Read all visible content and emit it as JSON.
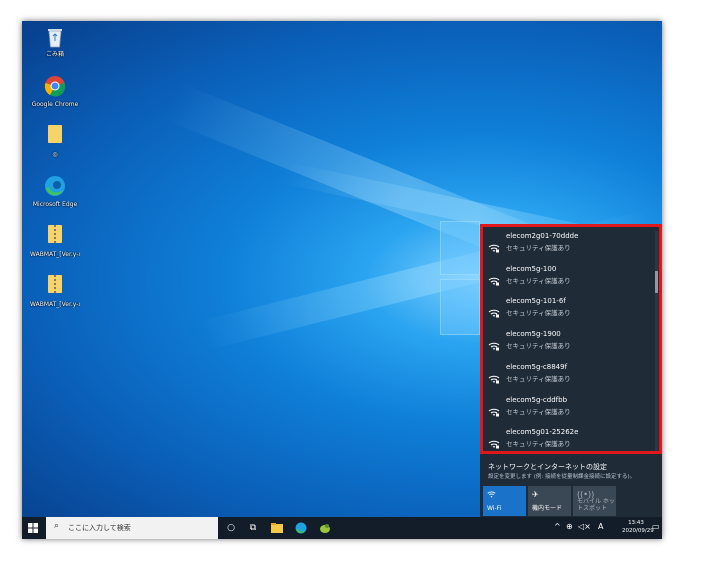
{
  "desktop": {
    "icons": [
      {
        "label": "ごみ箱",
        "kind": "recycle"
      },
      {
        "label": "Google Chrome",
        "kind": "chrome"
      },
      {
        "label": "◎",
        "kind": "folder"
      },
      {
        "label": "Microsoft Edge",
        "kind": "edge"
      },
      {
        "label": "WABMAT_[Ver.y-x...",
        "kind": "zip"
      },
      {
        "label": "WABMAT_[Ver.y-x...",
        "kind": "zip"
      }
    ]
  },
  "flyout": {
    "networks": [
      {
        "ssid": "elecom2g01-70ddde",
        "security": "セキュリティ保護あり"
      },
      {
        "ssid": "elecom5g-100",
        "security": "セキュリティ保護あり"
      },
      {
        "ssid": "elecom5g-101-6f",
        "security": "セキュリティ保護あり"
      },
      {
        "ssid": "elecom5g-1900",
        "security": "セキュリティ保護あり"
      },
      {
        "ssid": "elecom5g-c8849f",
        "security": "セキュリティ保護あり"
      },
      {
        "ssid": "elecom5g-cddfbb",
        "security": "セキュリティ保護あり"
      },
      {
        "ssid": "elecom5g01-25262e",
        "security": "セキュリティ保護あり"
      }
    ],
    "settings_title": "ネットワークとインターネットの設定",
    "settings_sub": "設定を変更します (例: 接続を従量制課金接続に設定する)。",
    "quick_actions": [
      {
        "label": "Wi-Fi",
        "active": true
      },
      {
        "label": "機内モード",
        "active": false
      },
      {
        "label": "モバイル ホットスポット",
        "active": false
      }
    ],
    "highlight_color": "#e0181c"
  },
  "taskbar": {
    "search_placeholder": "ここに入力して検索",
    "ime": "A",
    "time": "13:43",
    "date": "2020/09/29"
  }
}
